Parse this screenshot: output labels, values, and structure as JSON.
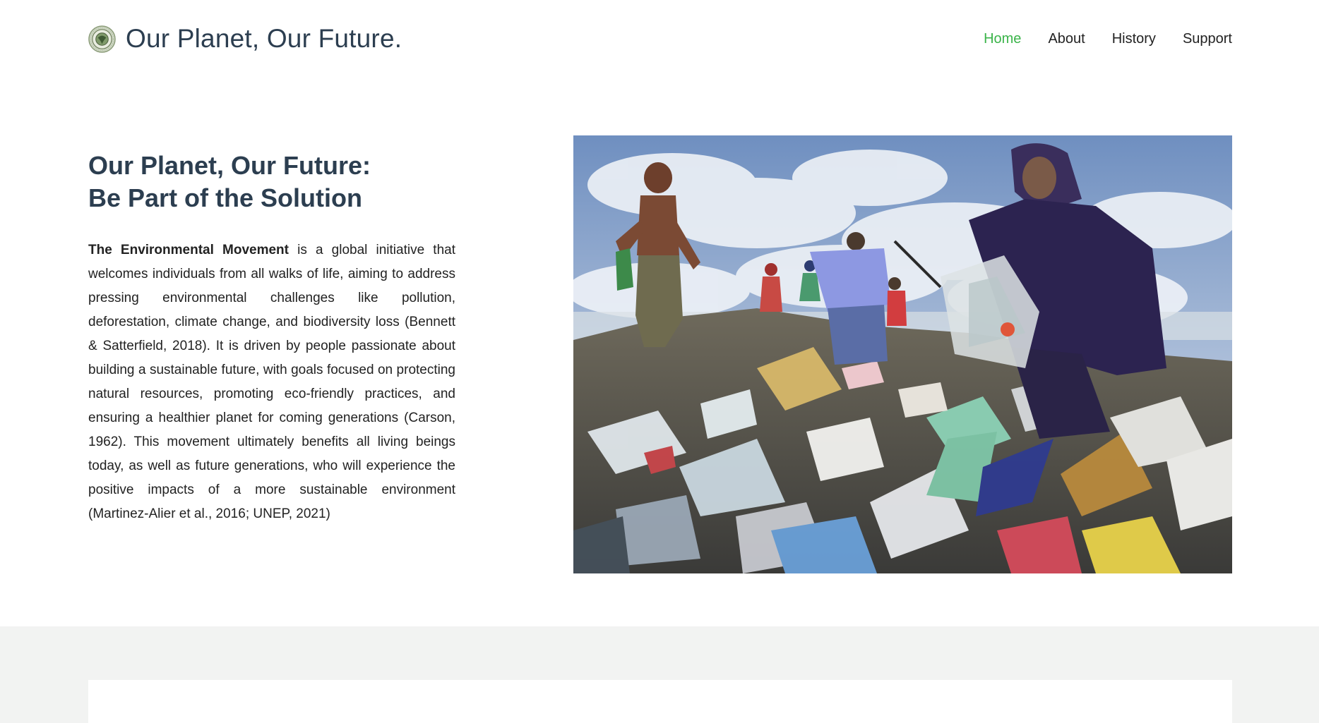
{
  "header": {
    "site_title": "Our Planet, Our Future.",
    "logo_icon": "globe-seal-icon",
    "nav": [
      {
        "label": "Home",
        "active": true
      },
      {
        "label": "About",
        "active": false
      },
      {
        "label": "History",
        "active": false
      },
      {
        "label": "Support",
        "active": false
      }
    ]
  },
  "hero": {
    "heading_line1": "Our Planet, Our Future:",
    "heading_line2": "Be Part of the Solution",
    "paragraph_lead": "The Environmental Movement",
    "paragraph_body": " is a global initiative that welcomes individuals from all walks of life, aiming to address pressing environmental challenges like pollution, deforestation, climate change, and biodiversity loss (Bennett & Satterfield, 2018). It is driven by people passionate about building a sustainable future, with goals focused on protecting natural resources, promoting eco-friendly practices, and ensuring a healthier planet for coming generations (Carson, 1962). This movement ultimately benefits all living beings today, as well as future generations, who will experience the positive impacts of a more sustainable environment (Martinez-Alier et al., 2016; UNEP, 2021)"
  },
  "colors": {
    "accent": "#3bb44a",
    "heading": "#2c3e50",
    "text": "#222222",
    "section_bg": "#f2f3f2"
  }
}
